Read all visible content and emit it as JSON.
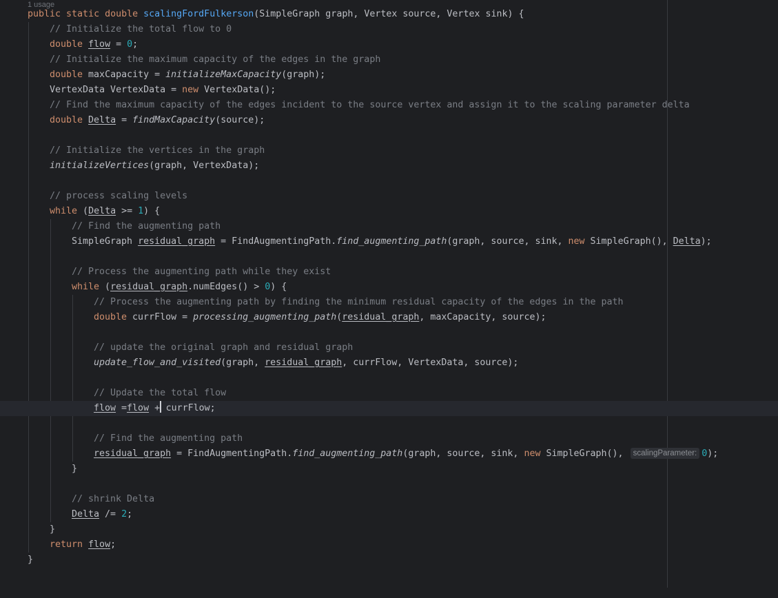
{
  "editor": {
    "header_hint": "1 usage",
    "lines": {
      "sig": {
        "kw": "public static double ",
        "method": "scalingFordFulkerson",
        "params": "(SimpleGraph graph, Vertex source, Vertex sink) {"
      },
      "l2": {
        "comment": "// Initialize the total flow to 0"
      },
      "l3": {
        "kw": "double ",
        "var": "flow",
        "eq": " = ",
        "num": "0",
        "end": ";"
      },
      "l4": {
        "comment": "// Initialize the maximum capacity of the edges in the graph"
      },
      "l5": {
        "kw": "double ",
        "plain": "maxCapacity = ",
        "call": "initializeMaxCapacity",
        "args": "(graph);"
      },
      "l6": {
        "plain": "VertexData VertexData = ",
        "kw": "new ",
        "rest": "VertexData();"
      },
      "l7": {
        "comment": "// Find the maximum capacity of the edges incident to the source vertex and assign it to the scaling parameter delta"
      },
      "l8": {
        "kw": "double ",
        "var": "Delta",
        "eq": " = ",
        "call": "findMaxCapacity",
        "args": "(source);"
      },
      "l10": {
        "comment": "// Initialize the vertices in the graph"
      },
      "l11": {
        "call": "initializeVertices",
        "args": "(graph, VertexData);"
      },
      "l13": {
        "comment": "// process scaling levels"
      },
      "l14": {
        "kw": "while ",
        "p1": "(",
        "var": "Delta",
        "op": " >= ",
        "num": "1",
        "end": ") {"
      },
      "l15": {
        "comment": "// Find the augmenting path"
      },
      "l16": {
        "p1": "SimpleGraph ",
        "var": "residual_graph",
        "p2": " = FindAugmentingPath.",
        "call": "find_augmenting_path",
        "p3": "(graph, source, sink, ",
        "kw": "new ",
        "p4": "SimpleGraph(), ",
        "var2": "Delta",
        "end": ");"
      },
      "l18": {
        "comment": "// Process the augmenting path while they exist"
      },
      "l19": {
        "kw": "while ",
        "p1": "(",
        "var": "residual_graph",
        "p2": ".numEdges() > ",
        "num": "0",
        "end": ") {"
      },
      "l20": {
        "comment": "// Process the augmenting path by finding the minimum residual capacity of the edges in the path"
      },
      "l21": {
        "kw": "double ",
        "p1": "currFlow = ",
        "call": "processing_augmenting_path",
        "p2": "(",
        "var": "residual_graph",
        "end": ", maxCapacity, source);"
      },
      "l23": {
        "comment": "// update the original graph and residual graph"
      },
      "l24": {
        "call": "update_flow_and_visited",
        "p1": "(graph, ",
        "var": "residual_graph",
        "end": ", currFlow, VertexData, source);"
      },
      "l26": {
        "comment": "// Update the total flow"
      },
      "l27": {
        "var": "flow",
        "p1": " =",
        "var2": "flow",
        "p2": " +",
        "end": " currFlow;"
      },
      "l29": {
        "comment": "// Find the augmenting path"
      },
      "l30": {
        "var": "residual_graph",
        "p1": " = FindAugmentingPath.",
        "call": "find_augmenting_path",
        "p2": "(graph, source, sink, ",
        "kw": "new ",
        "p3": "SimpleGraph(), ",
        "hint": "scalingParameter:",
        "num": "0",
        "end": ");"
      },
      "l31": {
        "text": "}"
      },
      "l33": {
        "comment": "// shrink Delta"
      },
      "l34": {
        "var": "Delta",
        "op": " /= ",
        "num": "2",
        "end": ";"
      },
      "l35": {
        "text": "}"
      },
      "l36": {
        "kw": "return ",
        "var": "flow",
        "end": ";"
      },
      "l37": {
        "text": "}"
      }
    }
  }
}
